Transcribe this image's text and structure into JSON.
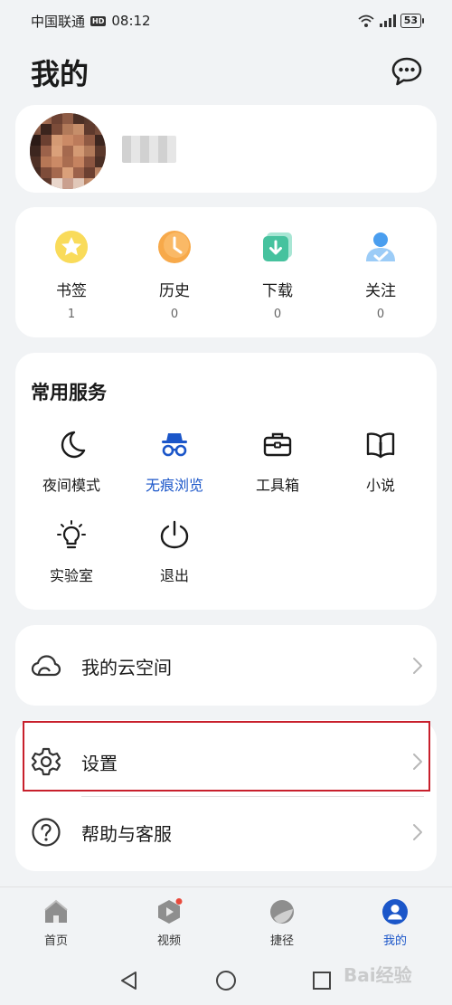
{
  "status_bar": {
    "carrier": "中国联通",
    "hd_badge": "HD",
    "time": "08:12",
    "battery": "53"
  },
  "header": {
    "title": "我的",
    "chat_icon": "chat-bubble-icon"
  },
  "stats": [
    {
      "label": "书签",
      "value": "1",
      "icon": "bookmark-star-icon",
      "color": "#f5c518"
    },
    {
      "label": "历史",
      "value": "0",
      "icon": "history-clock-icon",
      "color": "#f5a742"
    },
    {
      "label": "下载",
      "value": "0",
      "icon": "download-icon",
      "color": "#3cbf9a"
    },
    {
      "label": "关注",
      "value": "0",
      "icon": "follow-user-icon",
      "color": "#3a8ee6"
    }
  ],
  "services": {
    "title": "常用服务",
    "items": [
      {
        "label": "夜间模式",
        "icon": "moon-icon"
      },
      {
        "label": "无痕浏览",
        "icon": "incognito-icon"
      },
      {
        "label": "工具箱",
        "icon": "toolbox-icon"
      },
      {
        "label": "小说",
        "icon": "book-icon"
      },
      {
        "label": "实验室",
        "icon": "lightbulb-icon"
      },
      {
        "label": "退出",
        "icon": "power-icon"
      }
    ]
  },
  "menu": {
    "cloud": "我的云空间",
    "settings": "设置",
    "help": "帮助与客服"
  },
  "bottom_nav": [
    {
      "label": "首页",
      "icon": "home-icon"
    },
    {
      "label": "视频",
      "icon": "video-icon"
    },
    {
      "label": "捷径",
      "icon": "shortcut-icon"
    },
    {
      "label": "我的",
      "icon": "profile-icon"
    }
  ],
  "watermark": "Bai经验",
  "colors": {
    "accent": "#1b56c9",
    "highlight": "#c8202c",
    "background": "#f1f3f5"
  }
}
